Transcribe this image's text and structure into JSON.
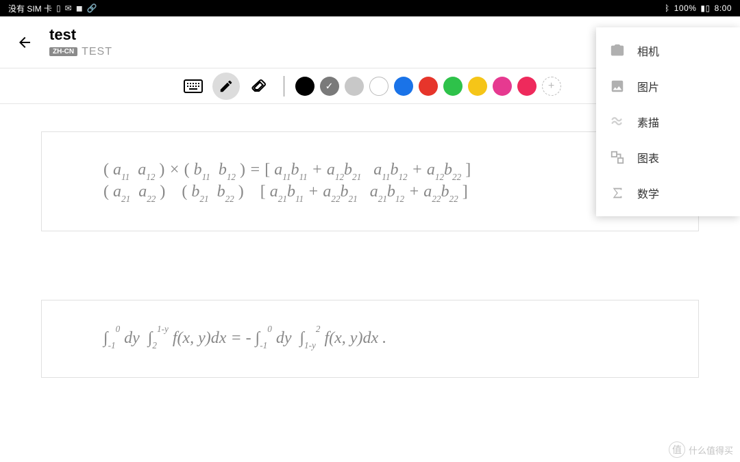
{
  "status": {
    "left_text": "没有 SIM 卡",
    "bluetooth": "100%",
    "time": "8:00"
  },
  "header": {
    "title": "test",
    "lang_badge": "ZH-CN",
    "subtitle": "TEST"
  },
  "toolbar": {
    "colors": [
      {
        "hex": "#000000",
        "selected": false
      },
      {
        "hex": "#7a7a7a",
        "selected": true
      },
      {
        "hex": "#c8c8c8",
        "selected": false
      },
      {
        "hex": "#ffffff",
        "selected": false,
        "outlined": true
      },
      {
        "hex": "#1a73e8",
        "selected": false
      },
      {
        "hex": "#e6352b",
        "selected": false
      },
      {
        "hex": "#2ec24a",
        "selected": false
      },
      {
        "hex": "#f5c518",
        "selected": false
      },
      {
        "hex": "#e63990",
        "selected": false
      },
      {
        "hex": "#ee2a5c",
        "selected": false
      }
    ]
  },
  "equations": {
    "box1_html": "<span class='upright'>(</span> a<sub>11</sub>&nbsp;&nbsp;a<sub>12</sub> <span class='upright'>)</span> × <span class='upright'>(</span> b<sub>11</sub>&nbsp;&nbsp;b<sub>12</sub> <span class='upright'>)</span> = <span class='upright'>[</span> a<sub>11</sub>b<sub>11</sub> + a<sub>12</sub>b<sub>21</sub>&nbsp;&nbsp;&nbsp;a<sub>11</sub>b<sub>12</sub> + a<sub>12</sub>b<sub>22</sub> <span class='upright'>]</span><br><span class='upright'>(</span> a<sub>21</sub>&nbsp;&nbsp;a<sub>22</sub> <span class='upright'>)</span> &nbsp;&nbsp; <span class='upright'>(</span> b<sub>21</sub>&nbsp;&nbsp;b<sub>22</sub> <span class='upright'>)</span> &nbsp;&nbsp; <span class='upright'>[</span> a<sub>21</sub>b<sub>11</sub> + a<sub>22</sub>b<sub>21</sub>&nbsp;&nbsp;&nbsp;a<sub>21</sub>b<sub>12</sub> + a<sub>22</sub>b<sub>22</sub> <span class='upright'>]</span>",
    "box2_html": "∫<sub>-1</sub><sup>0</sup> dy&nbsp; ∫<sub>2</sub><sup>1-y</sup> f(x, y)dx = - ∫<sub>-1</sub><sup>0</sup> dy&nbsp; ∫<sub>1-y</sub><sup>2</sup> f(x, y)dx ."
  },
  "menu": {
    "items": [
      {
        "label": "相机",
        "icon": "camera-icon"
      },
      {
        "label": "图片",
        "icon": "image-icon"
      },
      {
        "label": "素描",
        "icon": "sketch-icon"
      },
      {
        "label": "图表",
        "icon": "diagram-icon"
      },
      {
        "label": "数学",
        "icon": "sigma-icon"
      }
    ]
  },
  "watermark": {
    "badge": "值",
    "text": "什么值得买"
  }
}
